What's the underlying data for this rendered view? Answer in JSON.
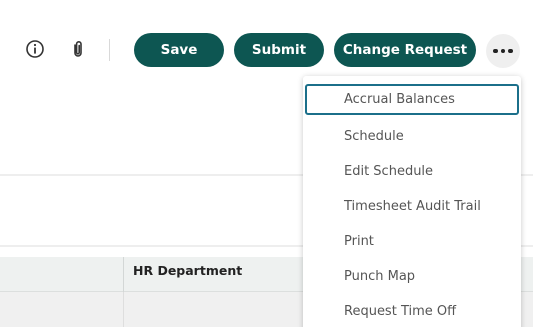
{
  "toolbar": {
    "info_icon": "info-icon",
    "attachment_icon": "paperclip-icon",
    "save_label": "Save",
    "submit_label": "Submit",
    "change_request_label": "Change Request",
    "more_icon": "more-horizontal-icon"
  },
  "table": {
    "columns": [
      "",
      "HR Department"
    ]
  },
  "menu": {
    "items": [
      "Accrual Balances",
      "Schedule",
      "Edit Schedule",
      "Timesheet Audit Trail",
      "Print",
      "Punch Map",
      "Request Time Off"
    ],
    "focused_index": 0
  },
  "colors": {
    "primary": "#0d5652",
    "focus_ring": "#1b6f8a",
    "table_header_bg": "#eef1f0"
  }
}
